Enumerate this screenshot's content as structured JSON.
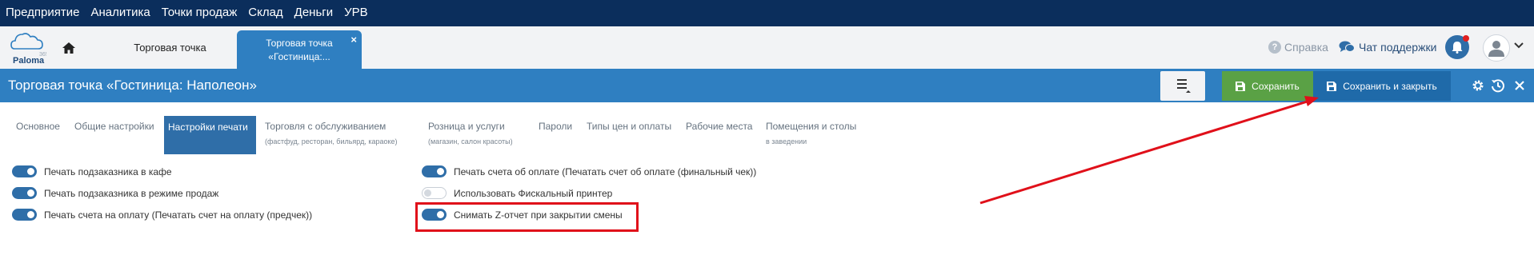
{
  "topnav": {
    "items": [
      "Предприятие",
      "Аналитика",
      "Точки продаж",
      "Склад",
      "Деньги",
      "УРВ"
    ]
  },
  "logo": {
    "text": "Paloma",
    "number": "365"
  },
  "tabs": {
    "inactive_label": "Торговая точка",
    "active_line1": "Торговая точка",
    "active_line2": "«Гостиница:...",
    "close": "×"
  },
  "header": {
    "help": "Справка",
    "support": "Чат поддержки"
  },
  "page": {
    "title": "Торговая точка «Гостиница: Наполеон»"
  },
  "toolbar": {
    "save": "Сохранить",
    "save_close": "Сохранить и закрыть"
  },
  "settings_tabs": [
    {
      "label": "Основное"
    },
    {
      "label": "Общие настройки"
    },
    {
      "label": "Настройки печати"
    },
    {
      "label": "Торговля с обслуживанием",
      "sub": "(фастфуд, ресторан, бильярд, караоке)"
    },
    {
      "label": "Розница и услуги",
      "sub": "(магазин, салон красоты)"
    },
    {
      "label": "Пароли"
    },
    {
      "label": "Типы цен и оплаты"
    },
    {
      "label": "Рабочие места"
    },
    {
      "label": "Помещения и столы",
      "sub": "в заведении"
    }
  ],
  "toggles_left": [
    {
      "label": "Печать подзаказника в кафе",
      "on": true
    },
    {
      "label": "Печать подзаказника в режиме продаж",
      "on": true
    },
    {
      "label": "Печать счета на оплату (Печатать счет на оплату (предчек))",
      "on": true
    }
  ],
  "toggles_right": [
    {
      "label": "Печать счета об оплате (Печатать счет об оплате (финальный чек))",
      "on": true
    },
    {
      "label": "Использовать Фискальный принтер",
      "on": false
    },
    {
      "label": "Снимать Z-отчет при закрытии смены",
      "on": true
    }
  ],
  "colors": {
    "nav": "#0b2e5c",
    "accent": "#2f7fc1",
    "save": "#5aa145",
    "annotation": "#e0101a"
  }
}
